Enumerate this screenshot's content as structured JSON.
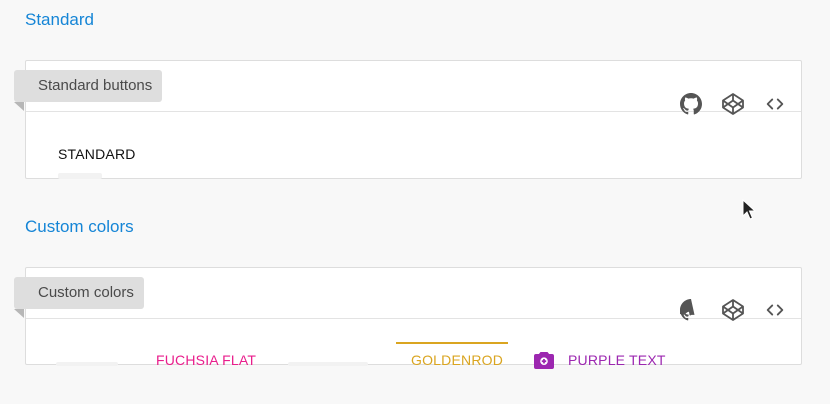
{
  "sections": {
    "standard": {
      "title": "Standard",
      "card_label": "Standard buttons",
      "buttons": {
        "standard": "STANDARD"
      }
    },
    "custom": {
      "title": "Custom colors",
      "card_label": "Custom colors",
      "buttons": {
        "fuchsia_flat": "FUCHSIA FLAT",
        "goldenrod": "GOLDENROD",
        "purple_text": "PURPLE TEXT"
      }
    }
  },
  "icons": {
    "github": "github-icon",
    "codepen": "codepen-icon",
    "code": "code-icon",
    "camera": "camera-icon"
  },
  "colors": {
    "section_title": "#1585d6",
    "fuchsia": "#e91e8c",
    "goldenrod": "#daa520",
    "purple": "#9c27b0",
    "icon": "#555555"
  }
}
